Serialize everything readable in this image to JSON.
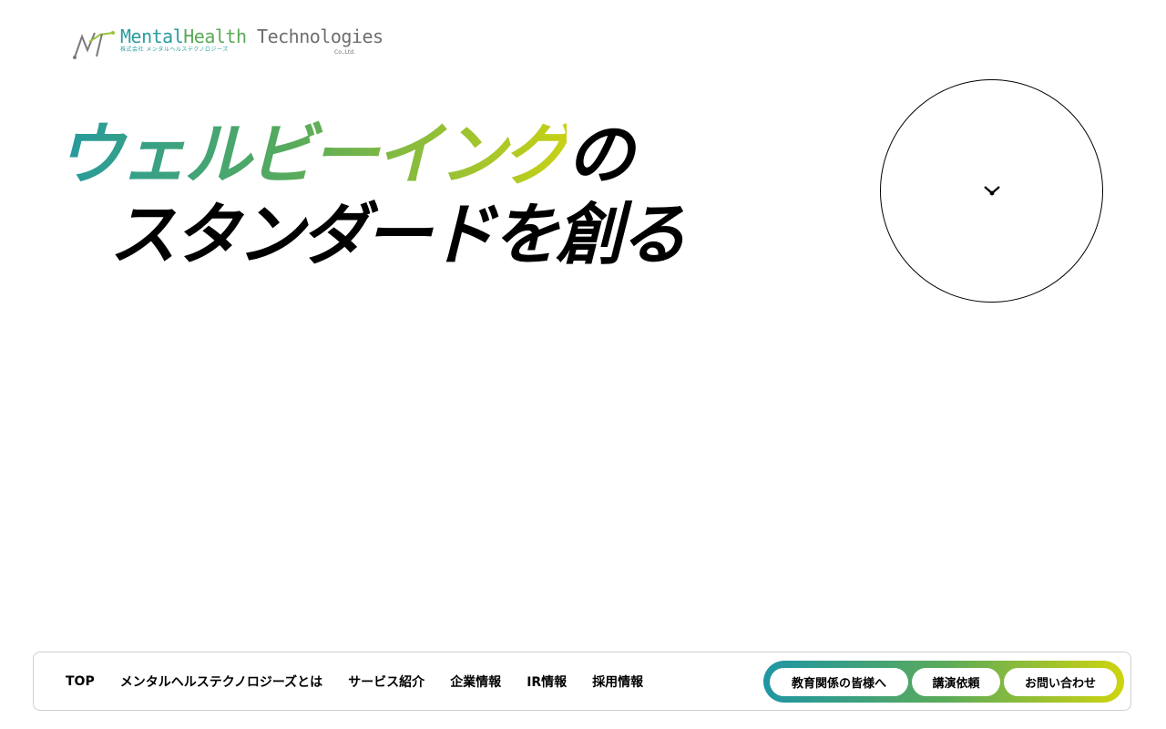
{
  "header": {
    "logo": {
      "name_part1": "Mental",
      "name_part2": "Health",
      "name_part3": "Technologies",
      "subtitle": "株式会社 メンタルヘルステクノロジーズ",
      "company_suffix": "Co.,Ltd."
    }
  },
  "hero": {
    "headline_highlight": "ウェルビーイング",
    "headline_particle": "の",
    "headline_line2": "スタンダードを創る",
    "scroll_icon": "chevron-down-icon"
  },
  "nav": {
    "links": [
      {
        "label": "TOP"
      },
      {
        "label": "メンタルヘルステクノロジーズとは"
      },
      {
        "label": "サービス紹介"
      },
      {
        "label": "企業情報"
      },
      {
        "label": "IR情報"
      },
      {
        "label": "採用情報"
      }
    ],
    "cta": {
      "education": "教育関係の皆様へ",
      "lecture": "講演依頼",
      "contact": "お問い合わせ"
    }
  },
  "colors": {
    "gradient_start": "#259a9f",
    "gradient_mid": "#55aa5d",
    "gradient_end": "#c8d116",
    "text": "#000000",
    "background": "#ffffff"
  }
}
